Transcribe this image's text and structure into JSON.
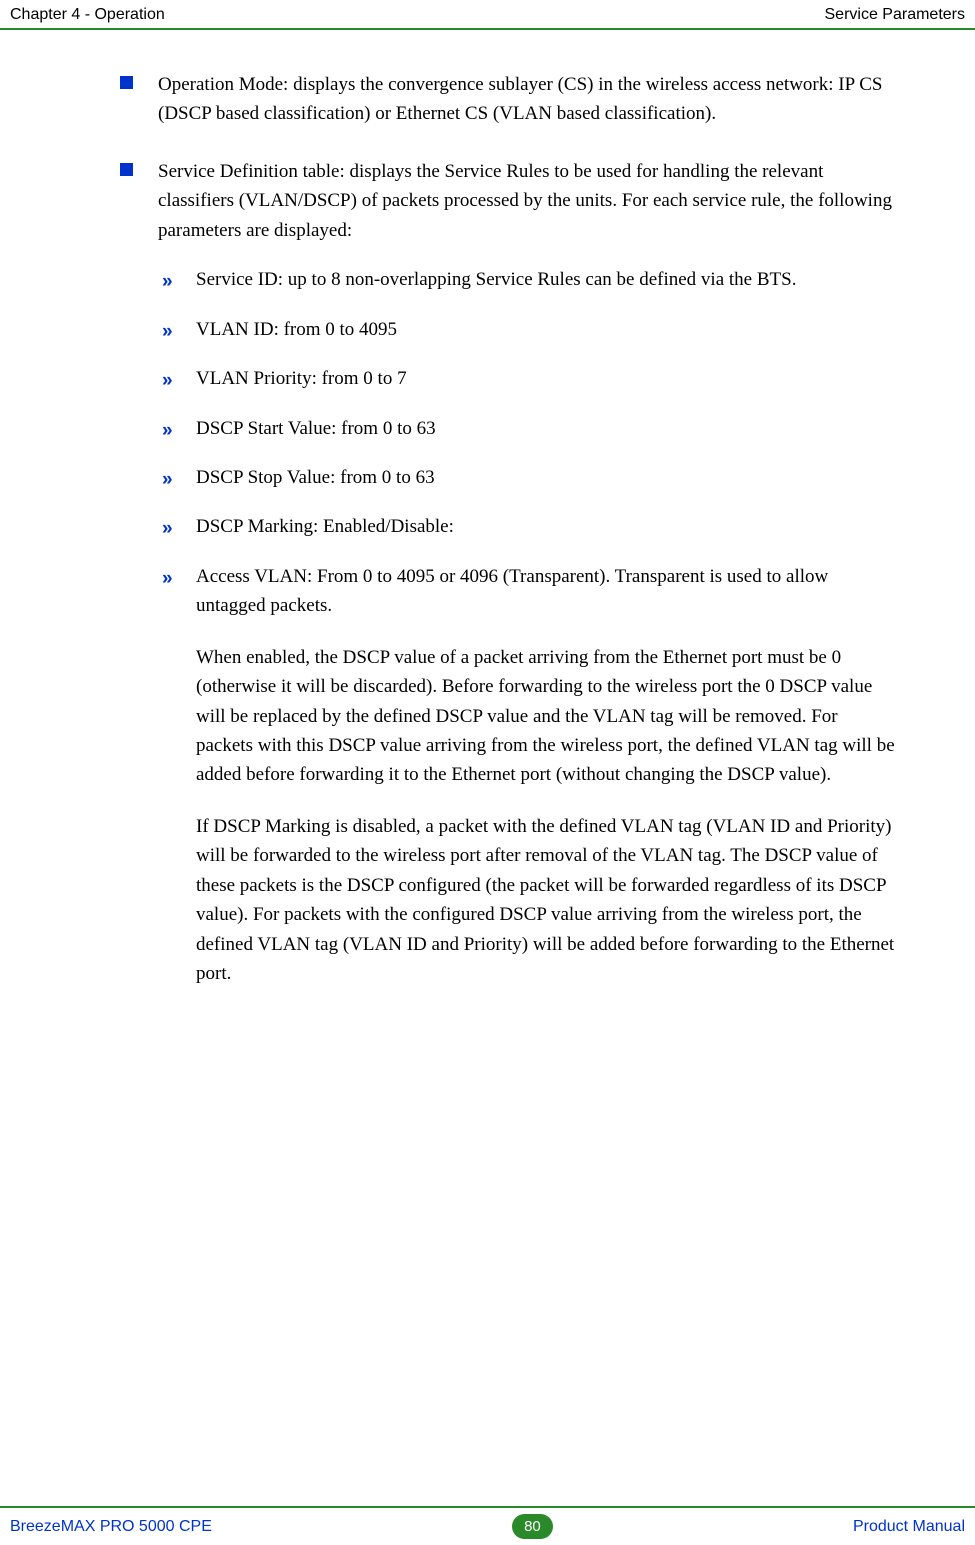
{
  "header": {
    "left": "Chapter 4 - Operation",
    "right": "Service Parameters"
  },
  "content": {
    "bullet1": "Operation Mode: displays the convergence sublayer (CS) in the wireless access network: IP CS (DSCP based classification) or Ethernet CS (VLAN based classification).",
    "bullet2_intro": "Service Definition table: displays the Service Rules to be used for handling the relevant classifiers (VLAN/DSCP) of packets processed by the units. For each service rule, the following parameters are displayed:",
    "subs": {
      "s1": "Service ID: up to 8 non-overlapping Service Rules can be defined via the BTS.",
      "s2": "VLAN ID: from 0 to 4095",
      "s3": "VLAN Priority: from 0 to 7",
      "s4": "DSCP Start Value: from 0 to 63",
      "s5": "DSCP Stop Value: from 0 to 63",
      "s6": "DSCP Marking: Enabled/Disable:",
      "s7": "Access VLAN: From 0 to 4095 or 4096 (Transparent). Transparent is used to allow untagged packets.",
      "p1": "When enabled, the DSCP value of a packet arriving from the Ethernet port must be 0 (otherwise it will be discarded). Before forwarding to the wireless port the 0 DSCP value will be replaced by the defined DSCP value and the VLAN tag will be removed. For packets with this DSCP value arriving from the wireless port, the defined VLAN tag will be added before forwarding it to the Ethernet port (without changing the DSCP value).",
      "p2": "If DSCP Marking is disabled, a packet with the defined VLAN tag (VLAN ID and Priority) will be forwarded to the wireless port after removal of the VLAN tag. The DSCP value of these packets is the DSCP configured (the packet will be forwarded regardless of its DSCP value). For packets with the configured DSCP value arriving from the wireless port, the defined VLAN tag (VLAN ID and Priority) will be added before forwarding to the Ethernet port."
    }
  },
  "footer": {
    "left": "BreezeMAX PRO 5000 CPE",
    "page": "80",
    "right": "Product Manual"
  }
}
